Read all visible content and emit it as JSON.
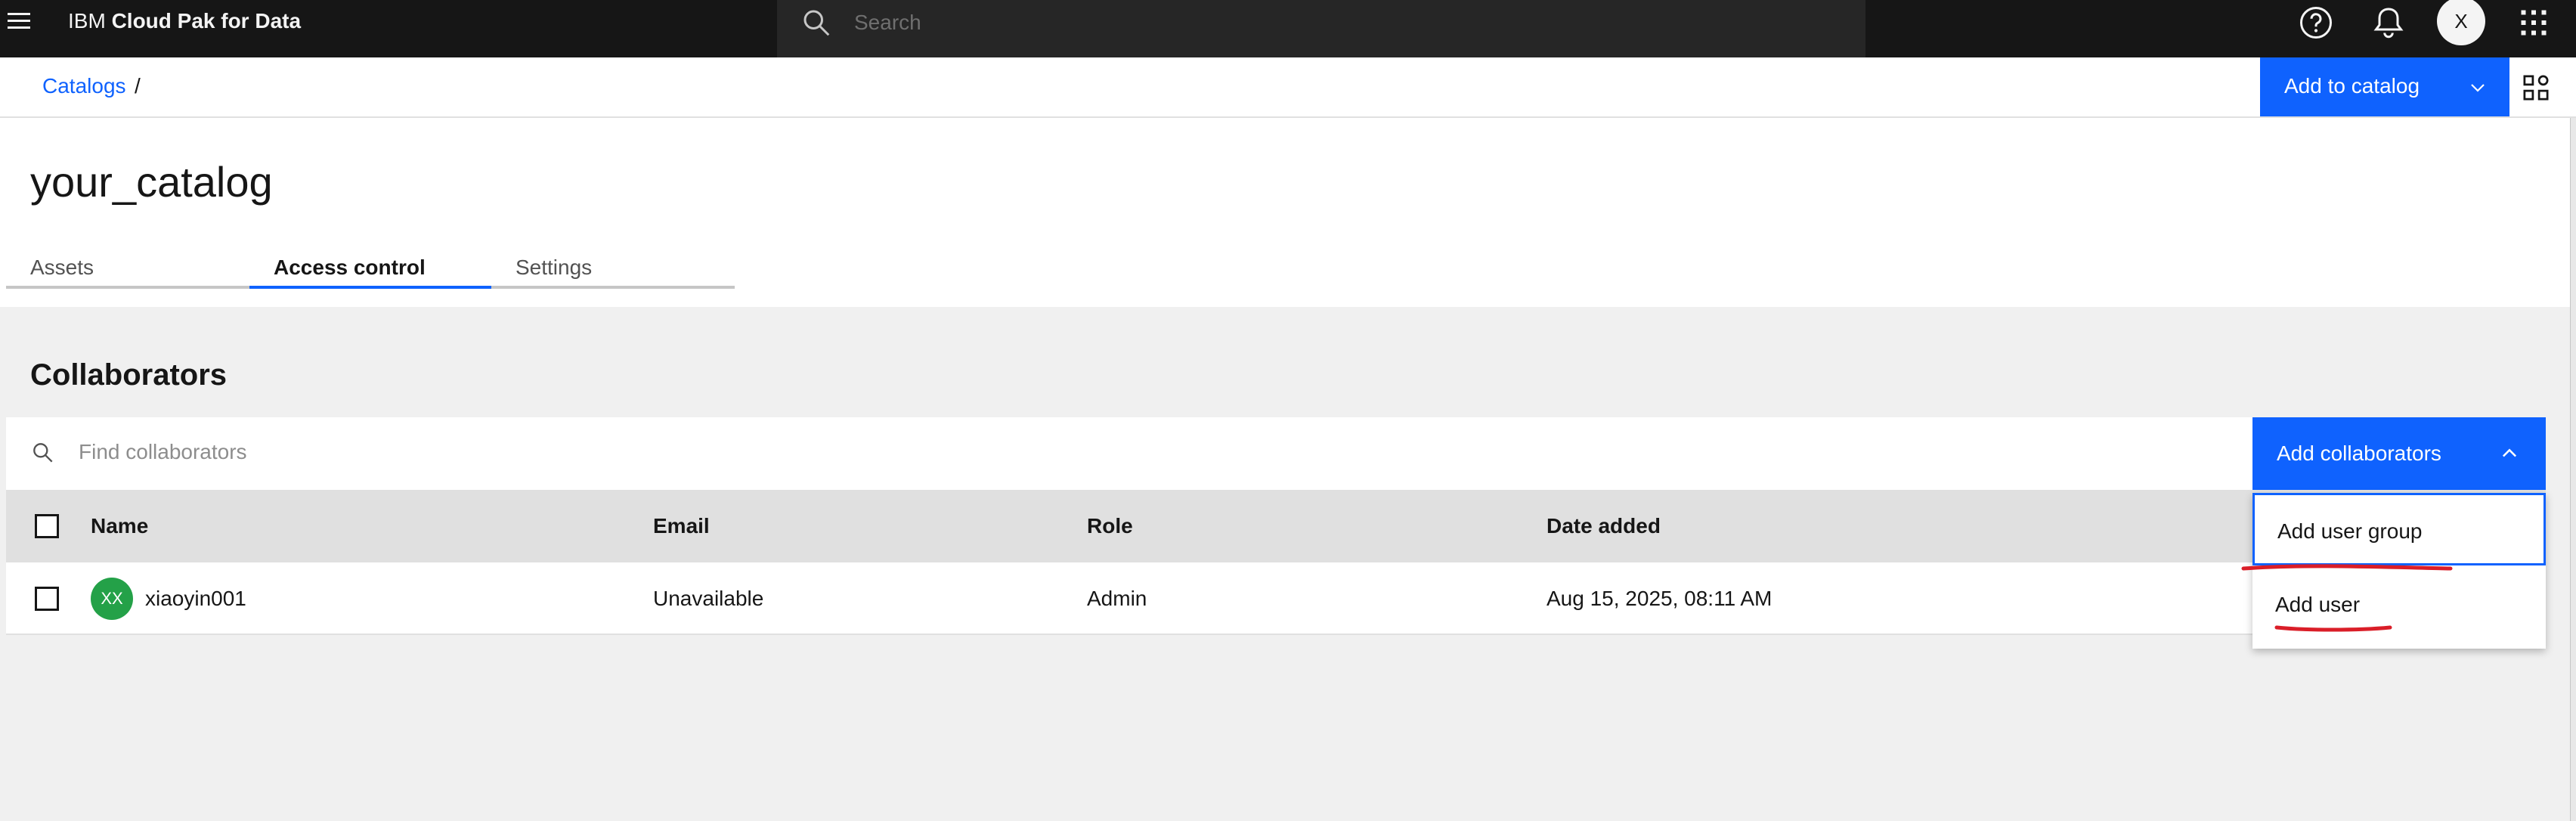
{
  "header": {
    "brand_prefix": "IBM",
    "brand_product": "Cloud Pak for Data",
    "search_placeholder": "Search",
    "avatar_initial": "X"
  },
  "breadcrumb": {
    "catalogs": "Catalogs",
    "separator": "/"
  },
  "actions": {
    "add_to_catalog": "Add to catalog"
  },
  "page": {
    "title": "your_catalog",
    "tabs": [
      {
        "label": "Assets",
        "active": false
      },
      {
        "label": "Access control",
        "active": true
      },
      {
        "label": "Settings",
        "active": false
      }
    ]
  },
  "collaborators": {
    "title": "Collaborators",
    "search_placeholder": "Find collaborators",
    "add_button": "Add collaborators",
    "columns": {
      "name": "Name",
      "email": "Email",
      "role": "Role",
      "date_added": "Date added"
    },
    "rows": [
      {
        "initials": "XX",
        "name": "xiaoyin001",
        "email": "Unavailable",
        "role": "Admin",
        "date_added": "Aug 15, 2025, 08:11 AM"
      }
    ],
    "menu": {
      "add_user_group": "Add user group",
      "add_user": "Add user"
    }
  },
  "colors": {
    "primary": "#0f62fe",
    "header_bg": "#161616",
    "avatar_green": "#24a148",
    "annotation_red": "#da1e28"
  }
}
